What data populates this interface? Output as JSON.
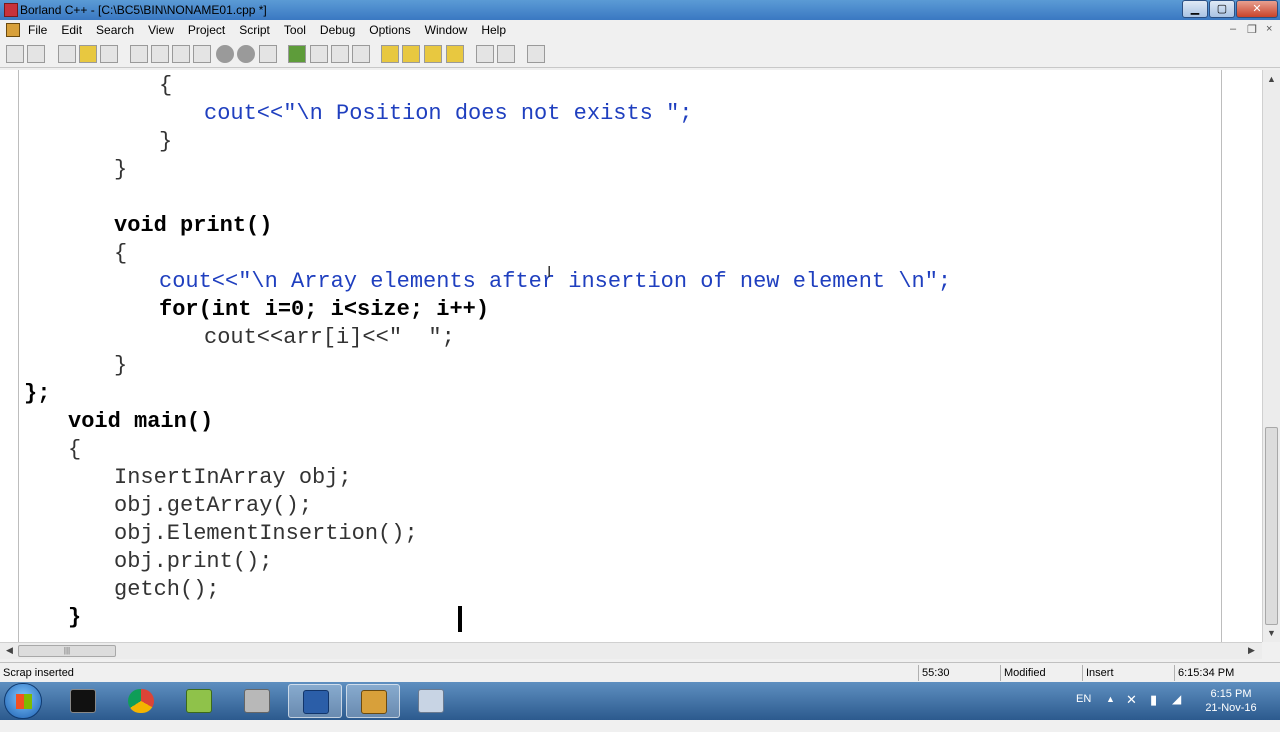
{
  "window": {
    "title": "Borland C++ - [C:\\BC5\\BIN\\NONAME01.cpp *]",
    "min_label": "▁",
    "max_label": "▢",
    "close_label": "✕"
  },
  "menu": {
    "items": [
      "File",
      "Edit",
      "Search",
      "View",
      "Project",
      "Script",
      "Tool",
      "Debug",
      "Options",
      "Window",
      "Help"
    ],
    "mdi_min": "–",
    "mdi_restore": "❐",
    "mdi_close": "×"
  },
  "editor": {
    "lines": [
      "{",
      "cout<<\"\\n Position does not exists \";",
      "}",
      "}",
      "",
      "void print()",
      "{",
      "cout<<\"\\n Array elements after insertion of new element \\n\";",
      "for(int i=0; i<size; i++)",
      "cout<<arr[i]<<\"  \";",
      "}",
      "};",
      "void main()",
      "{",
      "InsertInArray obj;",
      "obj.getArray();",
      "obj.ElementInsertion();",
      "obj.print();",
      "getch();",
      "}"
    ]
  },
  "status": {
    "message": "Scrap inserted",
    "position": "55:30",
    "modified": "Modified",
    "mode": "Insert",
    "time": "6:15:34 PM"
  },
  "taskbar": {
    "language": "EN",
    "clock_time": "6:15 PM",
    "clock_date": "21-Nov-16",
    "apps": [
      "command-prompt",
      "chrome",
      "notepad",
      "printer",
      "word",
      "borland",
      "calculator"
    ]
  },
  "colors": {
    "keyword": "#000000",
    "string": "#1f3fbf",
    "plain": "#333333",
    "titlebar": "#3a78c2"
  }
}
